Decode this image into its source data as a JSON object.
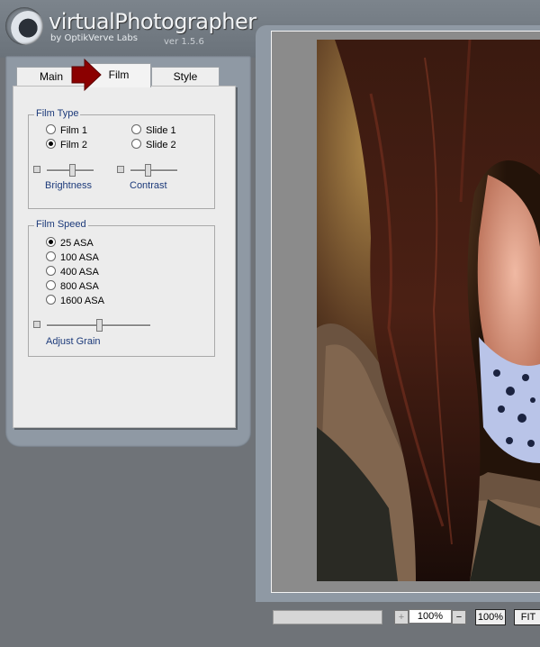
{
  "app": {
    "title": "virtualPhotographer",
    "byline": "by OptikVerve Labs",
    "version": "ver 1.5.6"
  },
  "tabs": [
    {
      "label": "Main"
    },
    {
      "label": "Film"
    },
    {
      "label": "Style"
    }
  ],
  "active_tab": "Film",
  "film_type": {
    "title": "Film Type",
    "options": [
      {
        "label": "Film 1",
        "selected": false
      },
      {
        "label": "Slide 1",
        "selected": false
      },
      {
        "label": "Film 2",
        "selected": true
      },
      {
        "label": "Slide 2",
        "selected": false
      }
    ],
    "brightness": {
      "label": "Brightness",
      "level": 0.55
    },
    "contrast": {
      "label": "Contrast",
      "level": 0.35
    }
  },
  "film_speed": {
    "title": "Film Speed",
    "options": [
      {
        "label": "25 ASA",
        "selected": true
      },
      {
        "label": "100 ASA",
        "selected": false
      },
      {
        "label": "400 ASA",
        "selected": false
      },
      {
        "label": "800 ASA",
        "selected": false
      },
      {
        "label": "1600 ASA",
        "selected": false
      }
    ],
    "grain": {
      "label": "Adjust Grain",
      "level": 0.5
    }
  },
  "zoom": {
    "zoom_in": "+",
    "value": "100%",
    "zoom_out": "−",
    "actual_size": "100%",
    "fit": "FIT"
  },
  "colors": {
    "accent": "#1c3a7a",
    "arrow": "#8b0000",
    "panel": "#8f99a4"
  }
}
